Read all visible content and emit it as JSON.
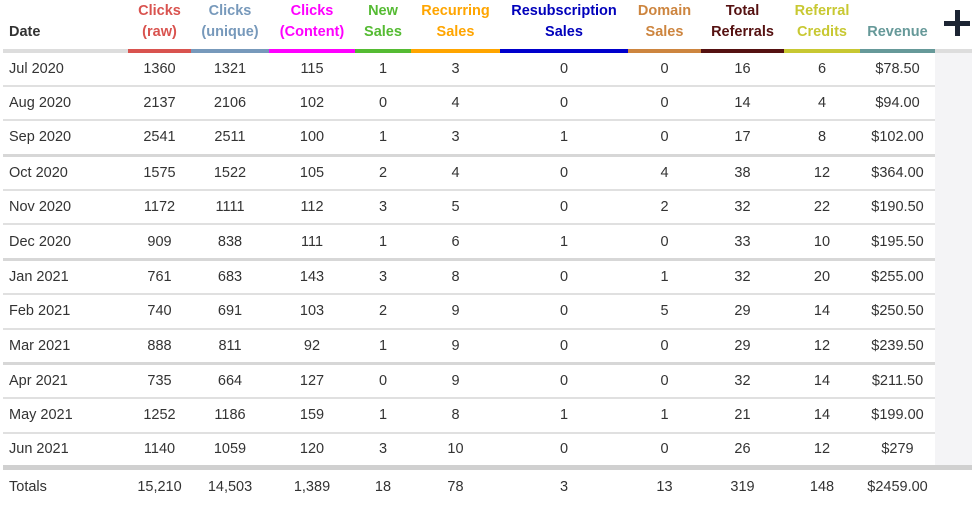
{
  "columns": [
    {
      "key": "date",
      "line1": "",
      "line2": "Date",
      "color": "#333333",
      "underline": "#dddddd"
    },
    {
      "key": "clicks_raw",
      "line1": "Clicks",
      "line2": "(raw)",
      "color": "#d9534f",
      "underline": "#d9534f"
    },
    {
      "key": "clicks_unique",
      "line1": "Clicks",
      "line2": "(unique)",
      "color": "#7799bb",
      "underline": "#7799bb"
    },
    {
      "key": "clicks_content",
      "line1": "Clicks",
      "line2": "(Content)",
      "color": "#ff00ff",
      "underline": "#ff00ff"
    },
    {
      "key": "new_sales",
      "line1": "New",
      "line2": "Sales",
      "color": "#55bb33",
      "underline": "#55bb33"
    },
    {
      "key": "recurring_sales",
      "line1": "Recurring",
      "line2": "Sales",
      "color": "#ffa500",
      "underline": "#ffa500"
    },
    {
      "key": "resubscription_sales",
      "line1": "Resubscription",
      "line2": "Sales",
      "color": "#0000bb",
      "underline": "#0000cc"
    },
    {
      "key": "domain_sales",
      "line1": "Domain",
      "line2": "Sales",
      "color": "#cd853f",
      "underline": "#cd853f"
    },
    {
      "key": "total_referrals",
      "line1": "Total",
      "line2": "Referrals",
      "color": "#551111",
      "underline": "#551111"
    },
    {
      "key": "referral_credits",
      "line1": "Referral",
      "line2": "Credits",
      "color": "#c8c832",
      "underline": "#c8c832"
    },
    {
      "key": "revenue",
      "line1": "",
      "line2": "Revenue",
      "color": "#669999",
      "underline": "#669999"
    }
  ],
  "add_column_icon": "plus-icon",
  "rows": [
    [
      "Jul 2020",
      "1360",
      "1321",
      "115",
      "1",
      "3",
      "0",
      "0",
      "16",
      "6",
      "$78.50"
    ],
    [
      "Aug 2020",
      "2137",
      "2106",
      "102",
      "0",
      "4",
      "0",
      "0",
      "14",
      "4",
      "$94.00"
    ],
    [
      "Sep 2020",
      "2541",
      "2511",
      "100",
      "1",
      "3",
      "1",
      "0",
      "17",
      "8",
      "$102.00"
    ],
    [
      "Oct 2020",
      "1575",
      "1522",
      "105",
      "2",
      "4",
      "0",
      "4",
      "38",
      "12",
      "$364.00"
    ],
    [
      "Nov 2020",
      "1172",
      "1111",
      "112",
      "3",
      "5",
      "0",
      "2",
      "32",
      "22",
      "$190.50"
    ],
    [
      "Dec 2020",
      "909",
      "838",
      "111",
      "1",
      "6",
      "1",
      "0",
      "33",
      "10",
      "$195.50"
    ],
    [
      "Jan 2021",
      "761",
      "683",
      "143",
      "3",
      "8",
      "0",
      "1",
      "32",
      "20",
      "$255.00"
    ],
    [
      "Feb 2021",
      "740",
      "691",
      "103",
      "2",
      "9",
      "0",
      "5",
      "29",
      "14",
      "$250.50"
    ],
    [
      "Mar 2021",
      "888",
      "811",
      "92",
      "1",
      "9",
      "0",
      "0",
      "29",
      "12",
      "$239.50"
    ],
    [
      "Apr 2021",
      "735",
      "664",
      "127",
      "0",
      "9",
      "0",
      "0",
      "32",
      "14",
      "$211.50"
    ],
    [
      "May 2021",
      "1252",
      "1186",
      "159",
      "1",
      "8",
      "1",
      "1",
      "21",
      "14",
      "$199.00"
    ],
    [
      "Jun 2021",
      "1140",
      "1059",
      "120",
      "3",
      "10",
      "0",
      "0",
      "26",
      "12",
      "$279"
    ]
  ],
  "totals": [
    "Totals",
    "15,210",
    "14,503",
    "1,389",
    "18",
    "78",
    "3",
    "13",
    "319",
    "148",
    "$2459.00"
  ],
  "extra_column_bg": "#f4f4f6"
}
